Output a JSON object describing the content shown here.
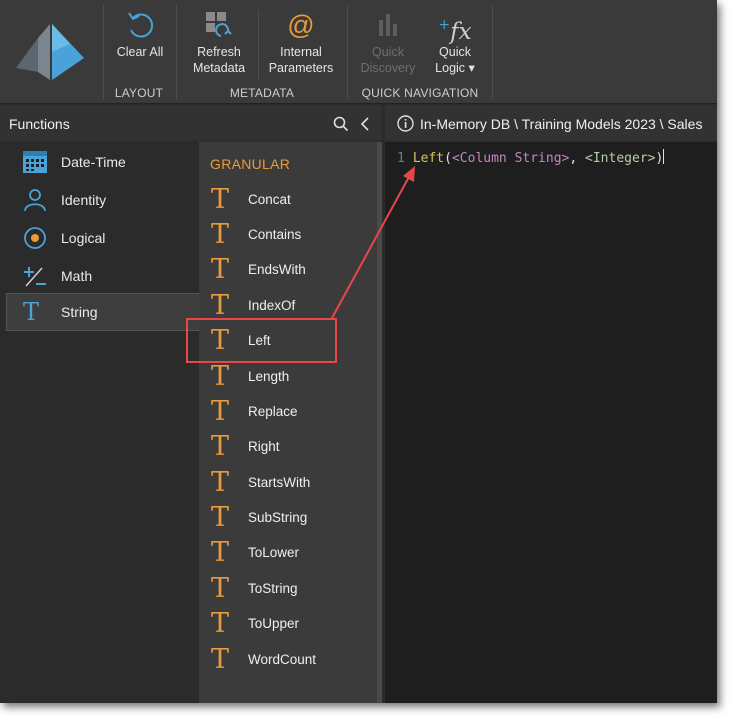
{
  "ribbon": {
    "clear_all": "Clear All",
    "refresh_metadata": "Refresh\nMetadata",
    "internal_parameters": "Internal\nParameters",
    "quick_discovery": "Quick\nDiscovery",
    "quick_logic": "Quick\nLogic ▾",
    "groups": {
      "layout": "LAYOUT",
      "metadata": "METADATA",
      "quick_navigation": "QUICK NAVIGATION"
    }
  },
  "functions_pane": {
    "title": "Functions",
    "categories": [
      {
        "label": "Date-Time",
        "icon": "calendar-icon"
      },
      {
        "label": "Identity",
        "icon": "person-icon"
      },
      {
        "label": "Logical",
        "icon": "radio-icon"
      },
      {
        "label": "Math",
        "icon": "plus-minus-icon"
      },
      {
        "label": "String",
        "icon": "text-t-icon",
        "selected": true
      }
    ],
    "granular_title": "GRANULAR",
    "functions": [
      "Concat",
      "Contains",
      "EndsWith",
      "IndexOf",
      "Left",
      "Length",
      "Replace",
      "Right",
      "StartsWith",
      "SubString",
      "ToLower",
      "ToString",
      "ToUpper",
      "WordCount"
    ]
  },
  "editor": {
    "path": "In-Memory DB \\ Training Models 2023 \\ Sales",
    "line_number": "1",
    "code_fn": "Left",
    "code_open": "(",
    "code_param1": "<Column String>",
    "code_comma": ", ",
    "code_param2": "<Integer>",
    "code_close": ")"
  },
  "colors": {
    "accent_orange": "#e89a3c",
    "annotation_red": "#e8474a",
    "logo_blue": "#4aa3d8"
  }
}
